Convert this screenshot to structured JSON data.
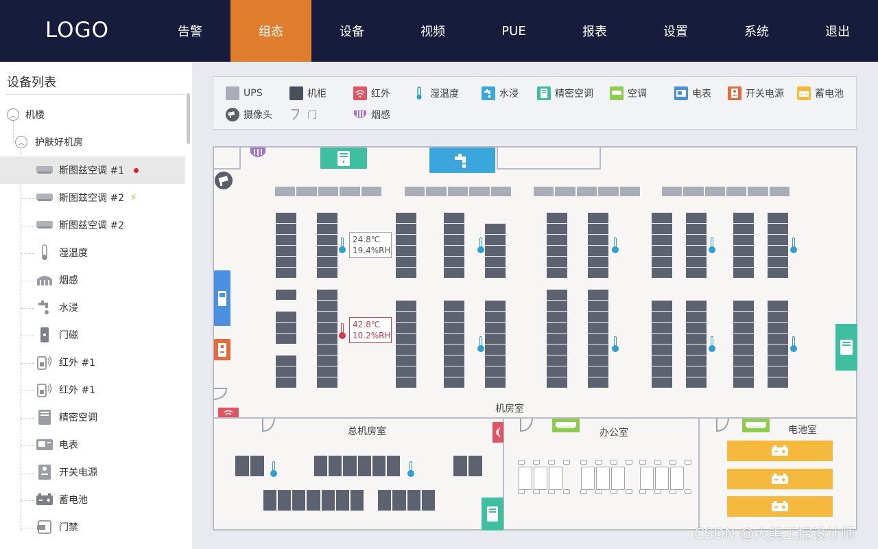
{
  "header": {
    "logo": "LOGO",
    "nav": [
      "告警",
      "组态",
      "设备",
      "视频",
      "PUE",
      "报表",
      "设置",
      "系统",
      "退出"
    ],
    "active_index": 1
  },
  "sidebar": {
    "title": "设备列表",
    "root": "机楼",
    "room": "护肤好机房",
    "items": [
      "斯图兹空调 #1",
      "斯图兹空调 #2",
      "斯图兹空调 #2",
      "湿温度",
      "烟感",
      "水浸",
      "门磁",
      "红外 #1",
      "红外 #1",
      "精密空调",
      "电表",
      "开关电源",
      "蓄电池",
      "门禁"
    ]
  },
  "legend": [
    "UPS",
    "机柜",
    "红外",
    "湿温度",
    "水浸",
    "精密空调",
    "空调",
    "电表",
    "开关电源",
    "蓄电池",
    "摄像头",
    "门",
    "烟感"
  ],
  "floor": {
    "sensor_normal": {
      "temp": "24.8℃",
      "humidity": "19.4%RH"
    },
    "sensor_alarm": {
      "temp": "42.8℃",
      "humidity": "10.2%RH"
    },
    "rooms": [
      "机房室",
      "总机房室",
      "办公室",
      "电池室"
    ]
  },
  "colors": {
    "nav_bg": "#171c3d",
    "active": "#e07d2c",
    "thermo": "#2b9fd6",
    "alarm": "#d43a4a",
    "precision_ac": "#3ebfa0",
    "ac": "#8fcc4e",
    "water": "#3aa6dc",
    "battery": "#f4b93d"
  },
  "watermark": "CSDN @大美工控设计师"
}
